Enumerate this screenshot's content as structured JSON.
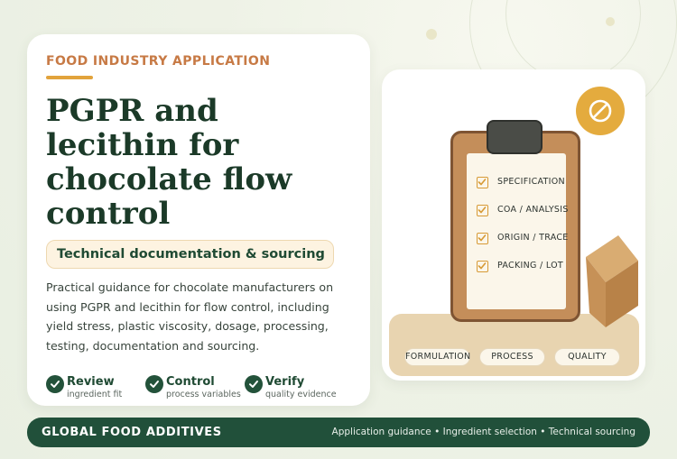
{
  "left_card": {
    "eyebrow": "FOOD INDUSTRY APPLICATION",
    "title": "PGPR and lecithin for chocolate flow control",
    "subtitle": "Technical documentation & sourcing",
    "description": "Practical guidance for chocolate manufacturers on using PGPR and lecithin for flow control, including yield stress, plastic viscosity, dosage, processing, testing, documentation and sourcing.",
    "features": [
      {
        "title": "Review",
        "sub": "ingredient fit",
        "icon": "check-circle-icon"
      },
      {
        "title": "Control",
        "sub": "process variables",
        "icon": "check-circle-icon"
      },
      {
        "title": "Verify",
        "sub": "quality evidence",
        "icon": "check-circle-icon"
      }
    ]
  },
  "right_card": {
    "checklist": [
      {
        "label": "SPECIFICATION"
      },
      {
        "label": "COA / ANALYSIS"
      },
      {
        "label": "ORIGIN / TRACE"
      },
      {
        "label": "PACKING / LOT"
      }
    ],
    "tags": [
      {
        "label": "FORMULATION"
      },
      {
        "label": "PROCESS"
      },
      {
        "label": "QUALITY"
      }
    ],
    "badge_icon": "prohibited-icon"
  },
  "footer": {
    "brand": "GLOBAL FOOD ADDITIVES",
    "tagline": "Application guidance • Ingredient selection • Technical sourcing"
  },
  "colors": {
    "accent_orange": "#c77a45",
    "accent_gold": "#e4ab3e",
    "brand_green": "#21503a",
    "heading_green": "#1b3a28"
  }
}
